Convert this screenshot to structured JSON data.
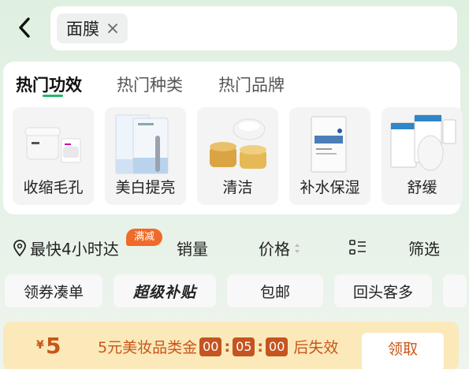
{
  "search": {
    "keyword": "面膜"
  },
  "categories": {
    "tabs": [
      {
        "label": "热门功效",
        "active": true
      },
      {
        "label": "热门种类",
        "active": false
      },
      {
        "label": "热门品牌",
        "active": false
      }
    ],
    "items": [
      {
        "label": "收缩毛孔"
      },
      {
        "label": "美白提亮"
      },
      {
        "label": "清洁"
      },
      {
        "label": "补水保湿"
      },
      {
        "label": "舒缓"
      }
    ]
  },
  "filters": {
    "delivery": "最快4小时达",
    "promo_badge": "满减",
    "sales": "销量",
    "price": "价格",
    "filter": "筛选"
  },
  "chips": [
    {
      "label": "领券凑单"
    },
    {
      "label": "超级补贴"
    },
    {
      "label": "包邮"
    },
    {
      "label": "回头客多"
    }
  ],
  "coupon": {
    "currency": "¥",
    "amount": "5",
    "desc": "5元美妆品类金",
    "timer": [
      "00",
      "05",
      "00"
    ],
    "suffix": "后失效",
    "button": "领取"
  },
  "colors": {
    "accent_green": "#21b86a",
    "promo_orange": "#f06a2a",
    "coupon_text": "#c8561a",
    "coupon_bg": "#fbe9b9"
  }
}
